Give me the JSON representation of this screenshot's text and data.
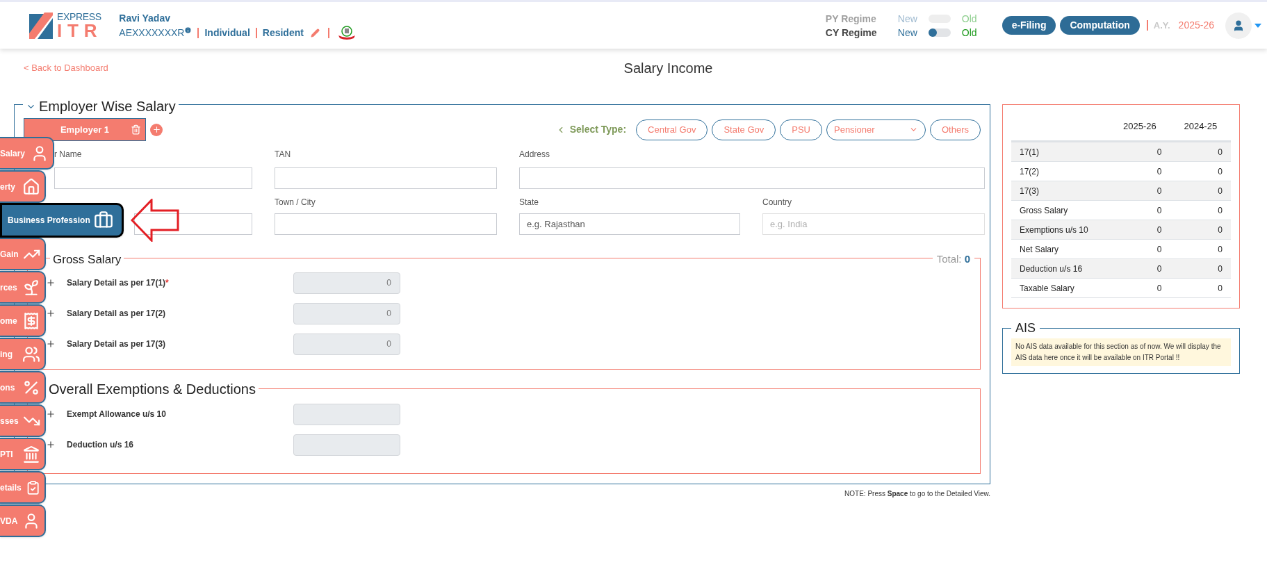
{
  "header": {
    "logo_top": "EXPRESS",
    "logo_bottom": "ITR",
    "user_name": "Ravi Yadav",
    "pan": "AEXXXXXXXR",
    "status": "Individual",
    "residency": "Resident",
    "regimes": [
      {
        "label": "PY Regime",
        "new": "New",
        "old": "Old",
        "disabled": true
      },
      {
        "label": "CY Regime",
        "new": "New",
        "old": "Old",
        "disabled": false,
        "old_selected": false
      }
    ],
    "buttons": [
      "e-Filing",
      "Computation"
    ],
    "ay_label": "A.Y.",
    "ay_value": "2025-26"
  },
  "back_link": "< Back to Dashboard",
  "page_title": "Salary Income",
  "employer_section": {
    "title": "Employer Wise Salary",
    "employers": [
      {
        "label": "Employer 1",
        "selected": true
      }
    ],
    "select_type_label": "Select Type:",
    "types": [
      {
        "kind": "button",
        "label": "Central Gov"
      },
      {
        "kind": "button",
        "label": "State Gov"
      },
      {
        "kind": "button",
        "label": "PSU"
      },
      {
        "kind": "select",
        "label": "Pensioner"
      },
      {
        "kind": "button",
        "label": "Others"
      }
    ],
    "row1": [
      {
        "label": "r Name"
      },
      {
        "label": "TAN"
      },
      {
        "label": "Address"
      }
    ],
    "row2": [
      {
        "label": "Town / City"
      },
      {
        "label": "State",
        "placeholder": "e.g. Rajasthan"
      },
      {
        "label": "Country",
        "placeholder": "e.g. India"
      }
    ]
  },
  "gross_salary": {
    "title": "Gross Salary",
    "total_label": "Total:",
    "total_value": "0",
    "required_mark": "*",
    "rows": [
      {
        "label": "Salary Detail as per 17(1)",
        "required": true,
        "value": "0"
      },
      {
        "label": "Salary Detail as per 17(2)",
        "required": false,
        "value": "0"
      },
      {
        "label": "Salary Detail as per 17(3)",
        "required": false,
        "value": "0"
      }
    ]
  },
  "exemptions": {
    "title": "Overall Exemptions & Deductions",
    "rows": [
      {
        "label": "Exempt Allowance u/s 10"
      },
      {
        "label": "Deduction u/s 16"
      }
    ]
  },
  "note": "NOTE: Press **Space** to go to the Detailed View.",
  "summary": {
    "columns": [
      "2025-26",
      "2024-25"
    ],
    "rows": [
      [
        "17(1)",
        "0",
        "0"
      ],
      [
        "17(2)",
        "0",
        "0"
      ],
      [
        "17(3)",
        "0",
        "0"
      ],
      [
        "Gross Salary",
        "0",
        "0"
      ],
      [
        "Exemptions u/s 10",
        "0",
        "0"
      ],
      [
        "Net Salary",
        "0",
        "0"
      ],
      [
        "Deduction u/s 16",
        "0",
        "0"
      ],
      [
        "Taxable Salary",
        "0",
        "0"
      ]
    ]
  },
  "ais": {
    "title": "AIS",
    "message": "No AIS data available for this section as of now. We will display the AIS data here once it will be available on ITR Portal !!"
  },
  "sidebar": [
    {
      "label": "Salary",
      "selected": false
    },
    {
      "label": "erty",
      "selected": false
    },
    {
      "label": "Business Profession",
      "selected": true
    },
    {
      "label": "Gain",
      "selected": false
    },
    {
      "label": "rces",
      "selected": false
    },
    {
      "label": "ome",
      "selected": false
    },
    {
      "label": "ing",
      "selected": false
    },
    {
      "label": "ons",
      "selected": false
    },
    {
      "label": "sses",
      "selected": false
    },
    {
      "label": "PTI",
      "selected": false
    },
    {
      "label": "etails",
      "selected": false
    },
    {
      "label": "VDA",
      "selected": false
    }
  ]
}
